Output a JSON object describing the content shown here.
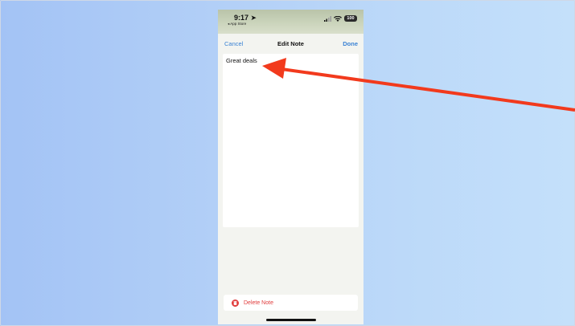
{
  "status_bar": {
    "time": "9:17",
    "back_label": "◂ App Store",
    "battery": "100"
  },
  "nav": {
    "cancel": "Cancel",
    "title": "Edit Note",
    "done": "Done"
  },
  "note": {
    "text": "Great deals"
  },
  "delete": {
    "label": "Delete Note"
  },
  "colors": {
    "accent": "#3a82d4",
    "destructive": "#e03b3b",
    "arrow": "#f23a1d"
  },
  "icons": [
    "location-arrow-icon",
    "signal-icon",
    "wifi-icon",
    "battery-icon",
    "trash-icon"
  ]
}
